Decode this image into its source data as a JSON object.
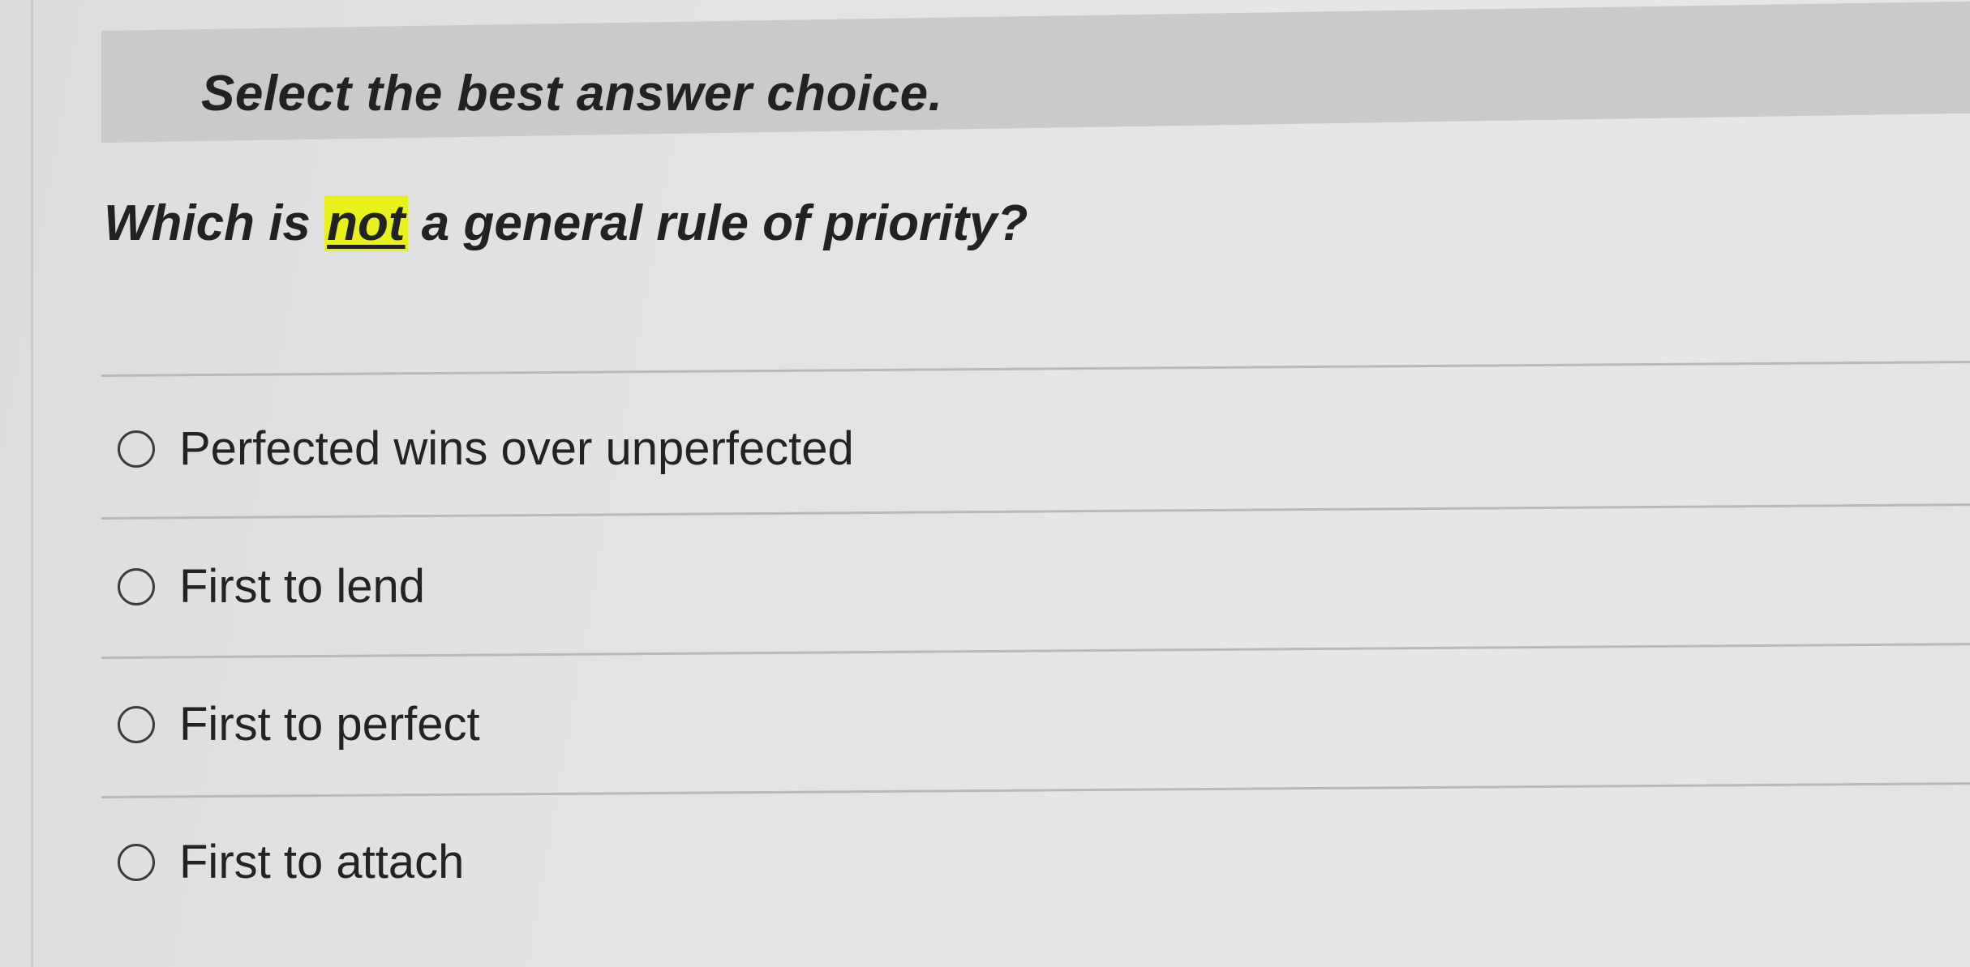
{
  "instruction": "Select the best answer choice.",
  "question": {
    "prefix": "Which is ",
    "emphasis": "not",
    "suffix": " a general rule of priority?"
  },
  "options": [
    {
      "label": "Perfected wins over unperfected",
      "selected": false
    },
    {
      "label": "First to lend",
      "selected": false
    },
    {
      "label": "First to perfect",
      "selected": false
    },
    {
      "label": "First to attach",
      "selected": false
    }
  ],
  "colors": {
    "highlight": "#e8f21a",
    "instruction_bar": "#c9caca"
  }
}
